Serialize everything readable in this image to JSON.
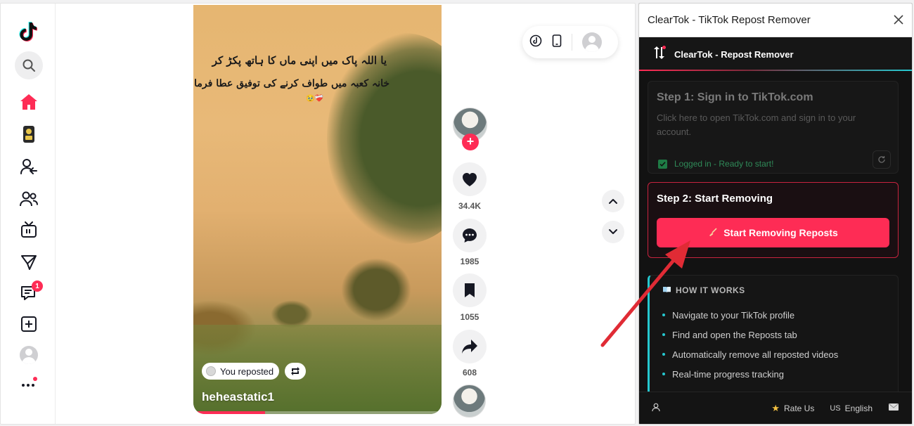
{
  "video": {
    "overlay_line1": "یا اللہ پاک میں اپنی ماں کا ہاتھ پکڑ کر",
    "overlay_line2": "خانہ کعبہ میں طواف کرنے کی توفیق عطا فرما۔",
    "overlay_emojis": "🥹❤️‍🩹",
    "repost_label": "You reposted",
    "username": "heheastatic1",
    "progress": 0.29
  },
  "actions": {
    "likes": "34.4K",
    "comments": "1985",
    "saves": "1055",
    "shares": "608"
  },
  "sidebar": {
    "messages_badge": "1"
  },
  "extension": {
    "window_title": "ClearTok - TikTok Repost Remover",
    "brand_title": "ClearTok - Repost Remover",
    "step1": {
      "title": "Step 1: Sign in to TikTok.com",
      "description": "Click here to open TikTok.com and sign in to your account.",
      "status": "Logged in - Ready to start!"
    },
    "step2": {
      "title": "Step 2: Start Removing",
      "button_label": "Start Removing Reposts"
    },
    "how_it_works": {
      "title": "HOW IT WORKS",
      "items": [
        "Navigate to your TikTok profile",
        "Find and open the Reposts tab",
        "Automatically remove all reposted videos",
        "Real-time progress tracking"
      ]
    },
    "footer": {
      "rate_label": "Rate Us",
      "language_flag": "US",
      "language_label": "English"
    }
  },
  "colors": {
    "tiktok_red": "#fe2c55",
    "accent_teal": "#25c9d0",
    "arrow_red": "#e02b35"
  }
}
